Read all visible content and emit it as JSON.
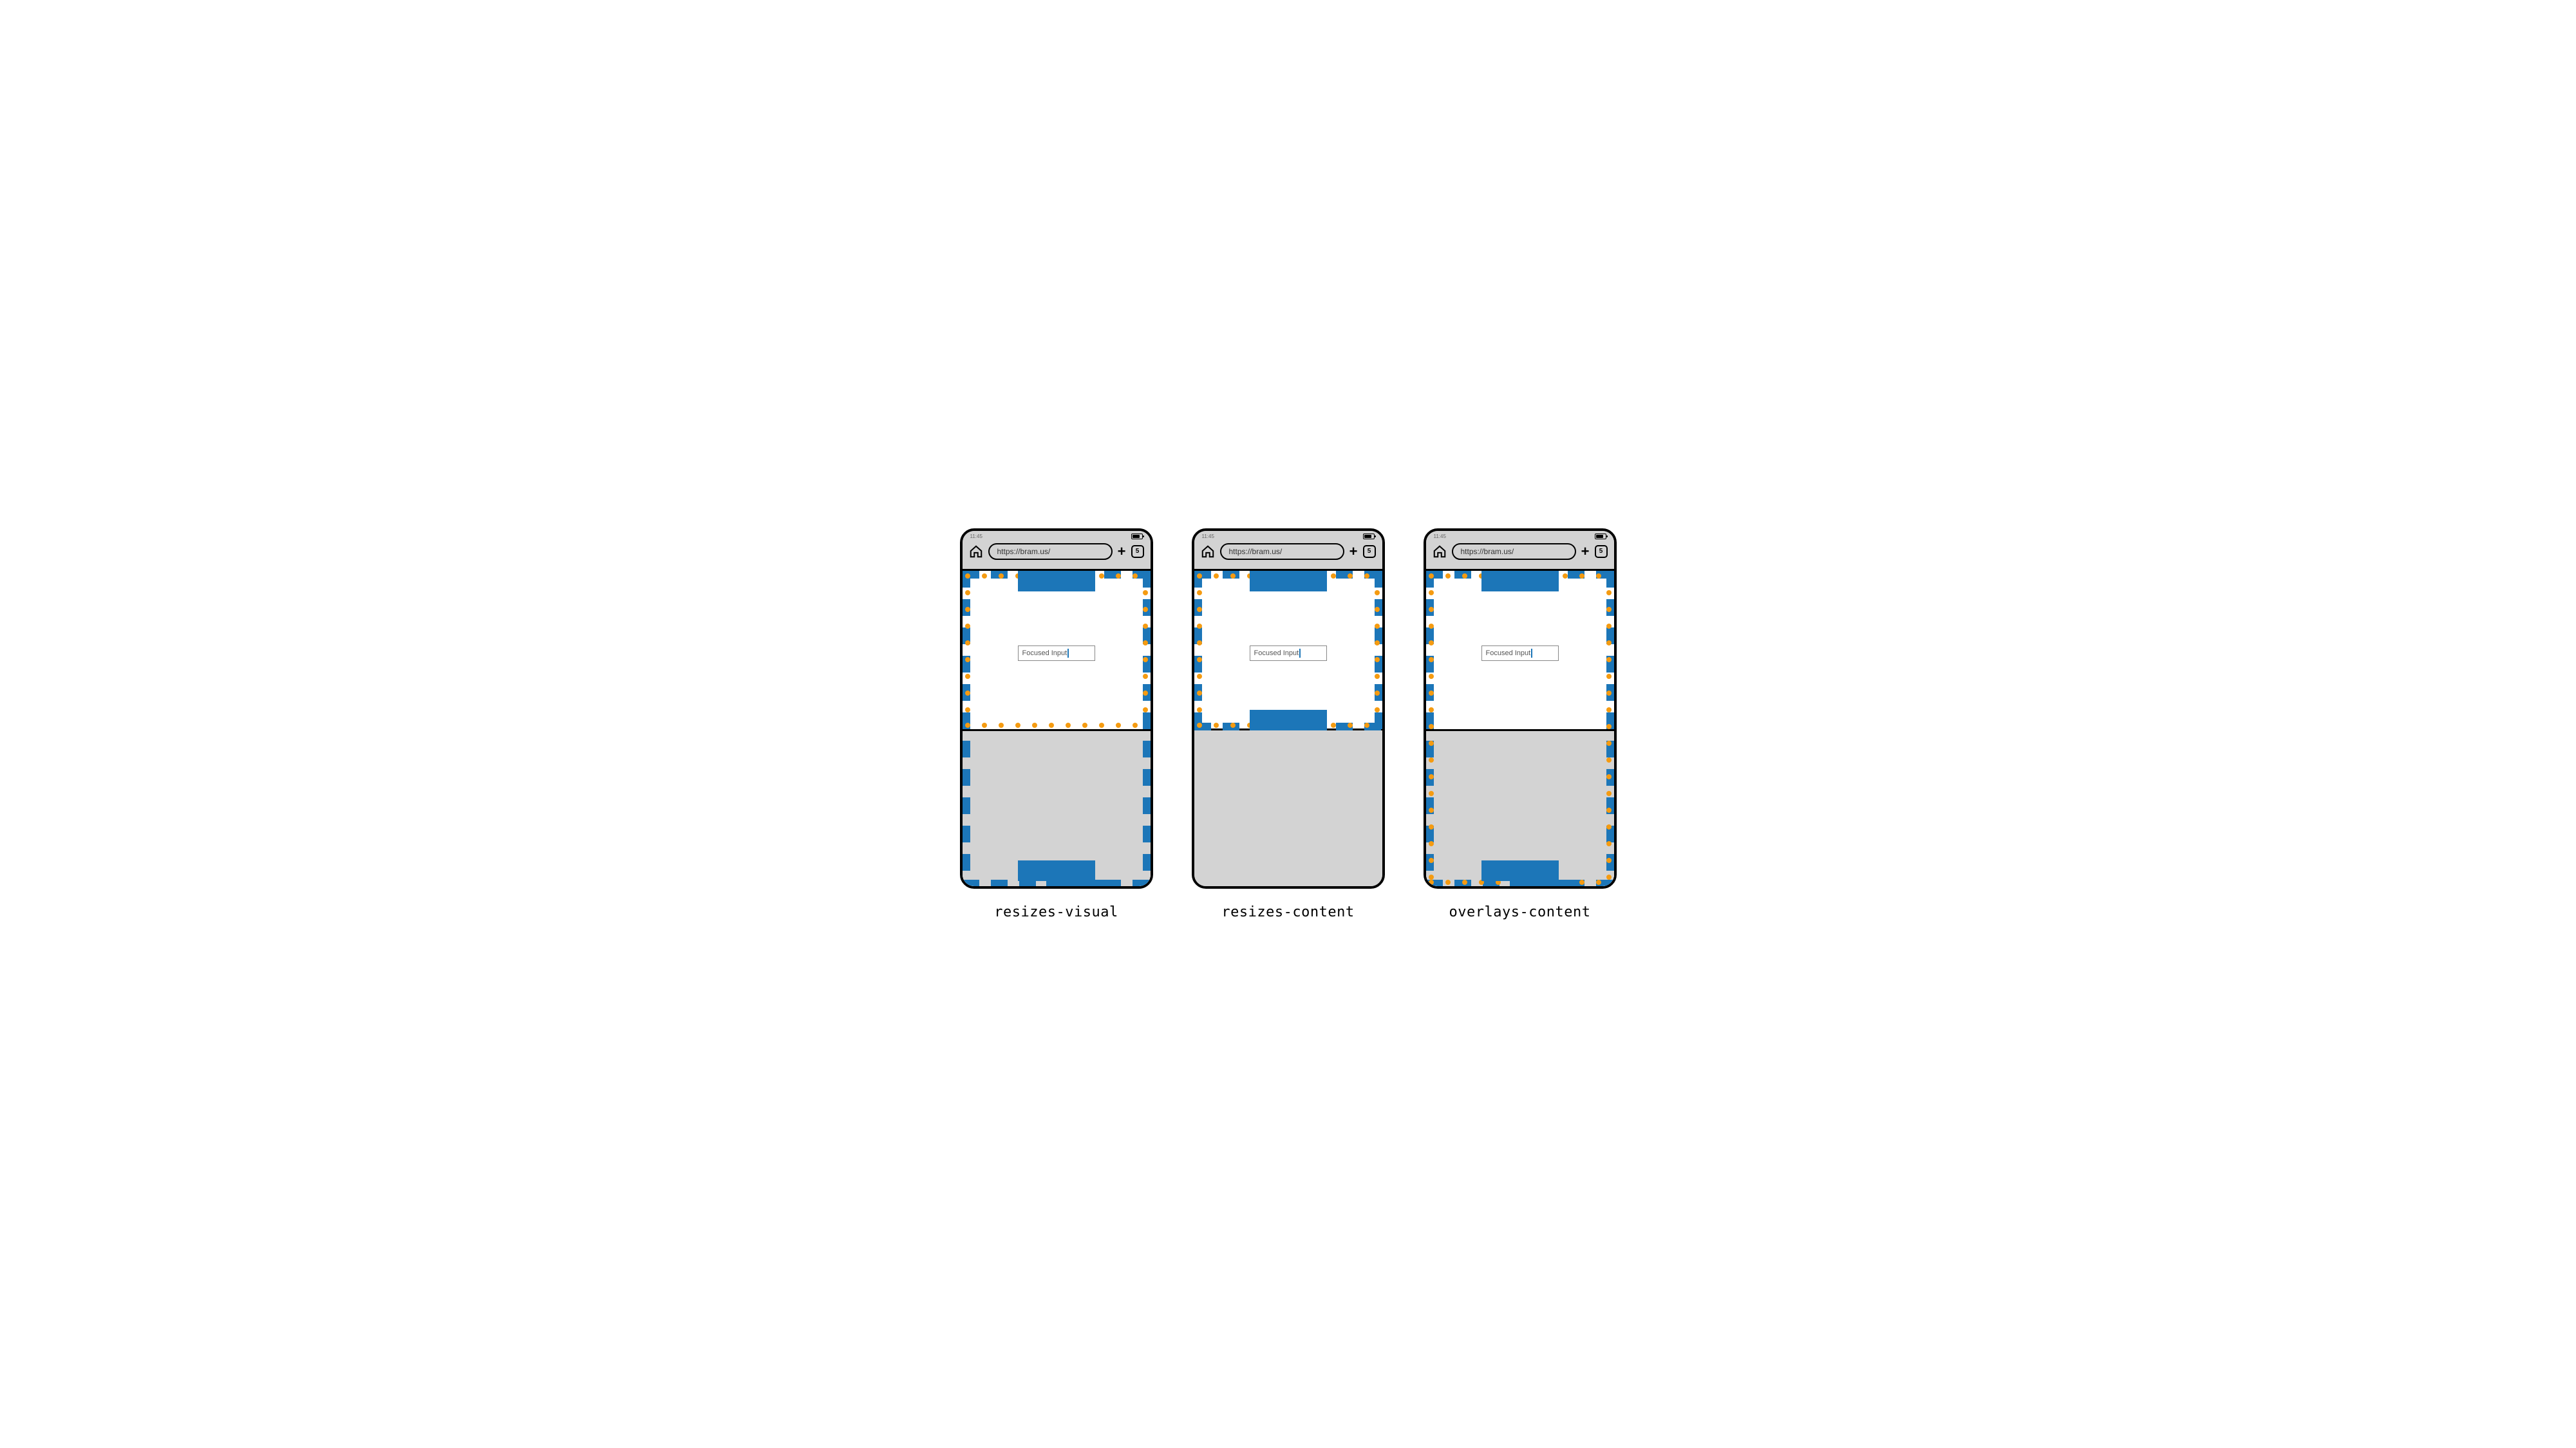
{
  "status": {
    "time": "11:45"
  },
  "toolbar": {
    "url": "https://bram.us/",
    "plus_label": "+",
    "tab_count": "5"
  },
  "content": {
    "input_label": "Focused Input"
  },
  "captions": {
    "a": "resizes-visual",
    "b": "resizes-content",
    "c": "overlays-content"
  },
  "diagram": {
    "description": "Three mobile browser mockups showing how the on-screen keyboard affects the layout viewport (blue dashed) and visual viewport (orange dotted) under three CSS virtual-keyboard modes.",
    "modes": [
      "resizes-visual",
      "resizes-content",
      "overlays-content"
    ],
    "colors": {
      "layout_viewport_dash": "#1c76b8",
      "visual_viewport_dot": "#f59b11",
      "chrome_bg": "#d3d3d3",
      "content_bg": "#ffffff"
    }
  }
}
